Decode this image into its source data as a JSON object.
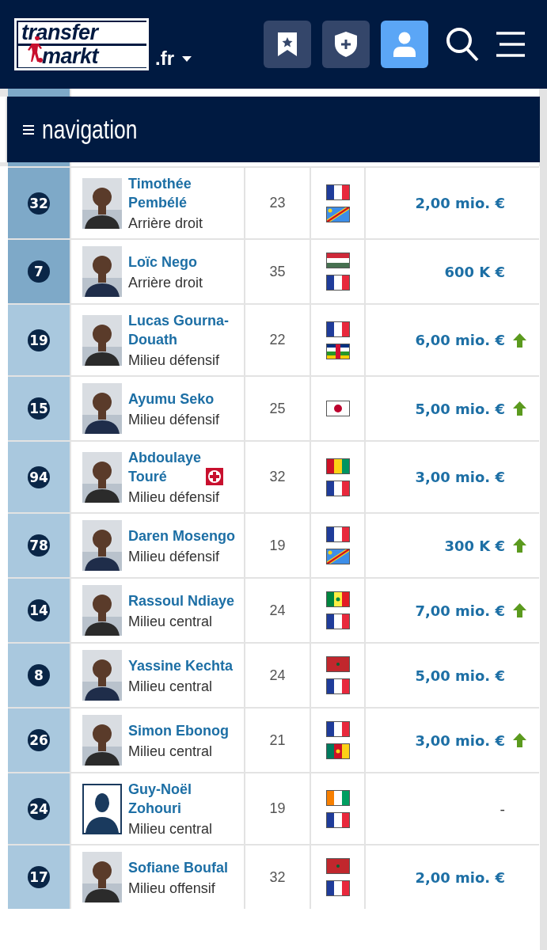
{
  "header": {
    "logo": {
      "line1": "transfer",
      "line2": "markt"
    },
    "domain": ".fr",
    "buttons": [
      {
        "kind": "bookmark",
        "selected": false
      },
      {
        "kind": "shield",
        "selected": false
      },
      {
        "kind": "user",
        "selected": true
      },
      {
        "kind": "search",
        "selected": false
      },
      {
        "kind": "menu",
        "selected": false
      }
    ]
  },
  "navigation": {
    "label": "navigation"
  },
  "players": [
    {
      "number": "32",
      "highlighted": true,
      "photo": {
        "kind": "picture"
      },
      "name": "Timothée Pembélé",
      "injured": false,
      "position": "Arrière droit",
      "age": "23",
      "flags": [
        {
          "kind": "fr"
        },
        {
          "kind": "cd"
        }
      ],
      "value": "2,00 mio. €",
      "trend_up": false
    },
    {
      "number": "7",
      "highlighted": true,
      "photo": {
        "kind": "picture"
      },
      "name": "Loïc Nego",
      "injured": false,
      "position": "Arrière droit",
      "age": "35",
      "flags": [
        {
          "kind": "hu"
        },
        {
          "kind": "fr"
        }
      ],
      "value": "600 K €",
      "trend_up": false
    },
    {
      "number": "19",
      "highlighted": false,
      "photo": {
        "kind": "picture"
      },
      "name": "Lucas Gourna-Douath",
      "injured": false,
      "position": "Milieu défensif",
      "age": "22",
      "flags": [
        {
          "kind": "fr"
        },
        {
          "kind": "cf"
        }
      ],
      "value": "6,00 mio. €",
      "trend_up": true
    },
    {
      "number": "15",
      "highlighted": false,
      "photo": {
        "kind": "picture"
      },
      "name": "Ayumu Seko",
      "injured": false,
      "position": "Milieu défensif",
      "age": "25",
      "flags": [
        {
          "kind": "jp"
        }
      ],
      "value": "5,00 mio. €",
      "trend_up": true
    },
    {
      "number": "94",
      "highlighted": false,
      "photo": {
        "kind": "picture"
      },
      "name": "Abdoulaye Touré",
      "injured": true,
      "position": "Milieu défensif",
      "age": "32",
      "flags": [
        {
          "kind": "gn"
        },
        {
          "kind": "fr"
        }
      ],
      "value": "3,00 mio. €",
      "trend_up": false
    },
    {
      "number": "78",
      "highlighted": false,
      "photo": {
        "kind": "picture"
      },
      "name": "Daren Mosengo",
      "injured": false,
      "position": "Milieu défensif",
      "age": "19",
      "flags": [
        {
          "kind": "fr"
        },
        {
          "kind": "cd"
        }
      ],
      "value": "300 K €",
      "trend_up": true
    },
    {
      "number": "14",
      "highlighted": false,
      "photo": {
        "kind": "picture"
      },
      "name": "Rassoul Ndiaye",
      "injured": false,
      "position": "Milieu central",
      "age": "24",
      "flags": [
        {
          "kind": "sn"
        },
        {
          "kind": "fr"
        }
      ],
      "value": "7,00 mio. €",
      "trend_up": true
    },
    {
      "number": "8",
      "highlighted": false,
      "photo": {
        "kind": "picture"
      },
      "name": "Yassine Kechta",
      "injured": false,
      "position": "Milieu central",
      "age": "24",
      "flags": [
        {
          "kind": "ma"
        },
        {
          "kind": "fr"
        }
      ],
      "value": "5,00 mio. €",
      "trend_up": false
    },
    {
      "number": "26",
      "highlighted": false,
      "photo": {
        "kind": "picture"
      },
      "name": "Simon Ebonog",
      "injured": false,
      "position": "Milieu central",
      "age": "21",
      "flags": [
        {
          "kind": "fr"
        },
        {
          "kind": "cm"
        }
      ],
      "value": "3,00 mio. €",
      "trend_up": true
    },
    {
      "number": "24",
      "highlighted": false,
      "photo": {
        "kind": "placeholder"
      },
      "name": "Guy-Noël Zohouri",
      "injured": false,
      "position": "Milieu central",
      "age": "19",
      "flags": [
        {
          "kind": "ci"
        },
        {
          "kind": "fr"
        }
      ],
      "value": "-",
      "trend_up": false
    },
    {
      "number": "17",
      "highlighted": false,
      "photo": {
        "kind": "picture"
      },
      "name": "Sofiane Boufal",
      "injured": false,
      "position": "Milieu offensif",
      "age": "32",
      "flags": [
        {
          "kind": "ma"
        },
        {
          "kind": "fr"
        }
      ],
      "value": "2,00 mio. €",
      "trend_up": false
    }
  ]
}
